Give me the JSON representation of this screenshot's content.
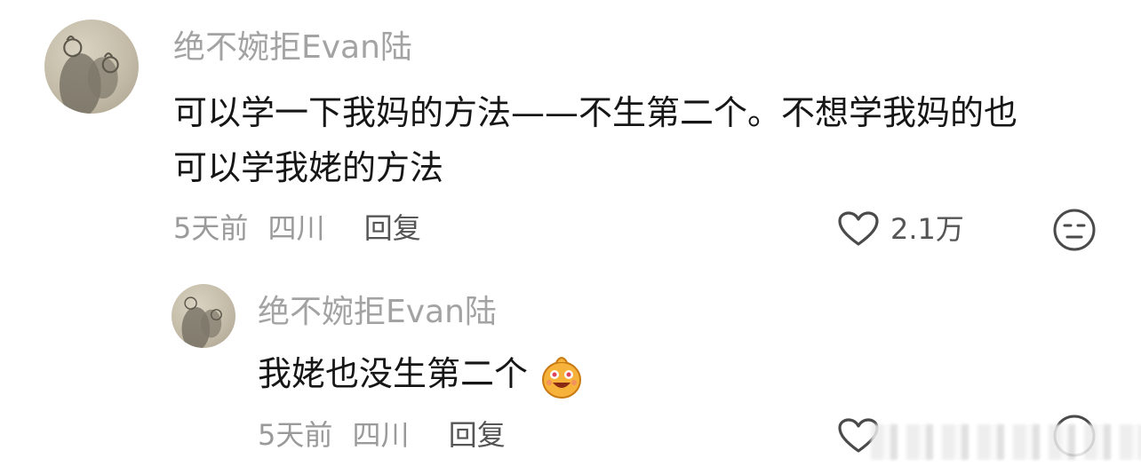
{
  "comment": {
    "username": "绝不婉拒Evan陆",
    "text_line1": "可以学一下我妈的方法——不生第二个。不想学我妈的也",
    "text_line2": "可以学我姥的方法",
    "time": "5天前",
    "location": "四川",
    "reply_label": "回复",
    "like_count": "2.1万"
  },
  "reply": {
    "username": "绝不婉拒Evan陆",
    "text": "我姥也没生第二个",
    "emoji": "smiling-face-emoji",
    "time": "5天前",
    "location": "四川",
    "reply_label": "回复"
  },
  "icons": {
    "like": "heart-icon",
    "dislike": "neutral-face-icon"
  },
  "colors": {
    "username": "#a3a3a3",
    "text": "#161616",
    "meta": "#9a9a9a",
    "icon": "#555555"
  }
}
